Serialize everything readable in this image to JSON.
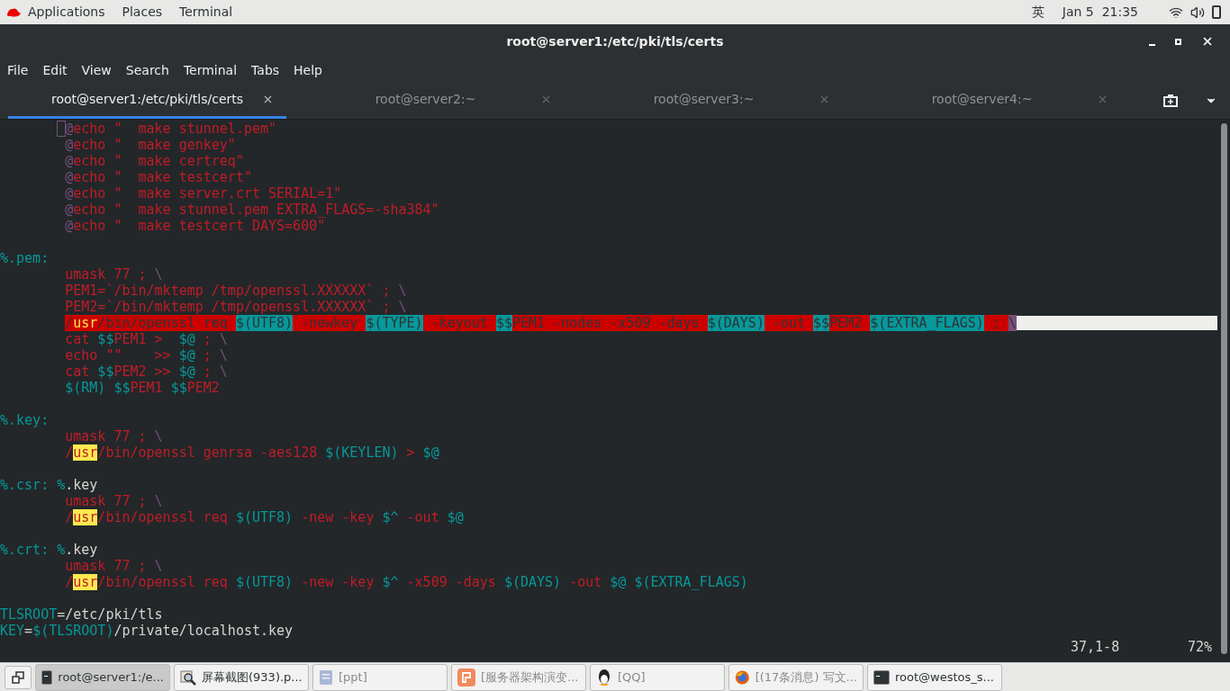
{
  "top_bar": {
    "menus": [
      "Applications",
      "Places",
      "Terminal"
    ],
    "input_method": "英",
    "clock": "Jan 5  21:35"
  },
  "window": {
    "title": "root@server1:/etc/pki/tls/certs"
  },
  "menu_bar": [
    "File",
    "Edit",
    "View",
    "Search",
    "Terminal",
    "Tabs",
    "Help"
  ],
  "tabs": [
    {
      "label": "root@server1:/etc/pki/tls/certs",
      "selected": true
    },
    {
      "label": "root@server2:~",
      "selected": false
    },
    {
      "label": "root@server3:~",
      "selected": false
    },
    {
      "label": "root@server4:~",
      "selected": false
    }
  ],
  "editor": {
    "lines": [
      {
        "indented": true,
        "cursor": true,
        "segments": [
          {
            "kind": "purple",
            "text": "@"
          },
          {
            "kind": "red",
            "text": "echo \"  make stunnel.pem\""
          }
        ]
      },
      {
        "indented": true,
        "segments": [
          {
            "kind": "purple",
            "text": "@"
          },
          {
            "kind": "red",
            "text": "echo \"  make genkey\""
          }
        ]
      },
      {
        "indented": true,
        "segments": [
          {
            "kind": "purple",
            "text": "@"
          },
          {
            "kind": "red",
            "text": "echo \"  make certreq\""
          }
        ]
      },
      {
        "indented": true,
        "segments": [
          {
            "kind": "purple",
            "text": "@"
          },
          {
            "kind": "red",
            "text": "echo \"  make testcert\""
          }
        ]
      },
      {
        "indented": true,
        "segments": [
          {
            "kind": "purple",
            "text": "@"
          },
          {
            "kind": "red",
            "text": "echo \"  make server.crt SERIAL=1\""
          }
        ]
      },
      {
        "indented": true,
        "segments": [
          {
            "kind": "purple",
            "text": "@"
          },
          {
            "kind": "red",
            "text": "echo \"  make stunnel.pem EXTRA_FLAGS=-sha384\""
          }
        ]
      },
      {
        "indented": true,
        "segments": [
          {
            "kind": "purple",
            "text": "@"
          },
          {
            "kind": "red",
            "text": "echo \"  make testcert DAYS=600\""
          }
        ]
      },
      {
        "kind": "blank"
      },
      {
        "segments": [
          {
            "kind": "cyan",
            "text": "%.pem:"
          }
        ]
      },
      {
        "indented": true,
        "segments": [
          {
            "kind": "red",
            "text": "umask 77 ; "
          },
          {
            "kind": "purple",
            "text": "\\"
          }
        ]
      },
      {
        "indented": true,
        "segments": [
          {
            "kind": "red",
            "text": "PEM1=`/bin/mktemp /tmp/openssl.XXXXXX` ; "
          },
          {
            "kind": "purple",
            "text": "\\"
          }
        ]
      },
      {
        "indented": true,
        "segments": [
          {
            "kind": "red",
            "text": "PEM2=`/bin/mktemp /tmp/openssl.XXXXXX` ; "
          },
          {
            "kind": "purple",
            "text": "\\"
          }
        ]
      },
      {
        "indented": true,
        "trailing_whitespace": true,
        "segments": [
          {
            "kind": "err",
            "text": "/"
          },
          {
            "kind": "errmatch",
            "text": "usr"
          },
          {
            "kind": "err",
            "text": "/bin/openssl req "
          },
          {
            "kind": "errvar",
            "text": "$(UTF8)"
          },
          {
            "kind": "err",
            "text": " -newkey "
          },
          {
            "kind": "errvar",
            "text": "$(TYPE)"
          },
          {
            "kind": "err",
            "text": " -keyout "
          },
          {
            "kind": "errvar",
            "text": "$$"
          },
          {
            "kind": "err",
            "text": "PEM1 -nodes -x509 -days "
          },
          {
            "kind": "errvar",
            "text": "$(DAYS)"
          },
          {
            "kind": "err",
            "text": " -out "
          },
          {
            "kind": "errvar",
            "text": "$$"
          },
          {
            "kind": "err",
            "text": "PEM2 "
          },
          {
            "kind": "errvar",
            "text": "$(EXTRA_FLAGS)"
          },
          {
            "kind": "err",
            "text": " ; "
          },
          {
            "kind": "errend",
            "text": "\\"
          }
        ]
      },
      {
        "indented": true,
        "segments": [
          {
            "kind": "red",
            "text": "cat "
          },
          {
            "kind": "cyan",
            "text": "$$"
          },
          {
            "kind": "red",
            "text": "PEM1 >  "
          },
          {
            "kind": "cyan",
            "text": "$@"
          },
          {
            "kind": "red",
            "text": " ; "
          },
          {
            "kind": "purple",
            "text": "\\"
          }
        ]
      },
      {
        "indented": true,
        "segments": [
          {
            "kind": "red",
            "text": "echo \"\"    >> "
          },
          {
            "kind": "cyan",
            "text": "$@"
          },
          {
            "kind": "red",
            "text": " ; "
          },
          {
            "kind": "purple",
            "text": "\\"
          }
        ]
      },
      {
        "indented": true,
        "segments": [
          {
            "kind": "red",
            "text": "cat "
          },
          {
            "kind": "cyan",
            "text": "$$"
          },
          {
            "kind": "red",
            "text": "PEM2 >> "
          },
          {
            "kind": "cyan",
            "text": "$@"
          },
          {
            "kind": "red",
            "text": " ; "
          },
          {
            "kind": "purple",
            "text": "\\"
          }
        ]
      },
      {
        "indented": true,
        "segments": [
          {
            "kind": "cyan",
            "text": "$(RM) $$"
          },
          {
            "kind": "red",
            "text": "PEM1 "
          },
          {
            "kind": "cyan",
            "text": "$$"
          },
          {
            "kind": "red",
            "text": "PEM2"
          }
        ]
      },
      {
        "kind": "blank"
      },
      {
        "segments": [
          {
            "kind": "cyan",
            "text": "%.key:"
          }
        ]
      },
      {
        "indented": true,
        "segments": [
          {
            "kind": "red",
            "text": "umask 77 ; "
          },
          {
            "kind": "purple",
            "text": "\\"
          }
        ]
      },
      {
        "indented": true,
        "segments": [
          {
            "kind": "red",
            "text": "/"
          },
          {
            "kind": "match",
            "text": "usr"
          },
          {
            "kind": "red",
            "text": "/bin/openssl genrsa -aes128 "
          },
          {
            "kind": "cyan",
            "text": "$(KEYLEN)"
          },
          {
            "kind": "red",
            "text": " > "
          },
          {
            "kind": "cyan",
            "text": "$@"
          }
        ]
      },
      {
        "kind": "blank"
      },
      {
        "segments": [
          {
            "kind": "cyan",
            "text": "%.csr: %"
          },
          {
            "kind": "white",
            "text": ".key"
          }
        ]
      },
      {
        "indented": true,
        "segments": [
          {
            "kind": "red",
            "text": "umask 77 ; "
          },
          {
            "kind": "purple",
            "text": "\\"
          }
        ]
      },
      {
        "indented": true,
        "segments": [
          {
            "kind": "red",
            "text": "/"
          },
          {
            "kind": "match",
            "text": "usr"
          },
          {
            "kind": "red",
            "text": "/bin/openssl req "
          },
          {
            "kind": "cyan",
            "text": "$(UTF8)"
          },
          {
            "kind": "red",
            "text": " -new -key "
          },
          {
            "kind": "cyan",
            "text": "$^"
          },
          {
            "kind": "red",
            "text": " -out "
          },
          {
            "kind": "cyan",
            "text": "$@"
          }
        ]
      },
      {
        "kind": "blank"
      },
      {
        "segments": [
          {
            "kind": "cyan",
            "text": "%.crt: %"
          },
          {
            "kind": "white",
            "text": ".key"
          }
        ]
      },
      {
        "indented": true,
        "segments": [
          {
            "kind": "red",
            "text": "umask 77 ; "
          },
          {
            "kind": "purple",
            "text": "\\"
          }
        ]
      },
      {
        "indented": true,
        "segments": [
          {
            "kind": "red",
            "text": "/"
          },
          {
            "kind": "match",
            "text": "usr"
          },
          {
            "kind": "red",
            "text": "/bin/openssl req "
          },
          {
            "kind": "cyan",
            "text": "$(UTF8)"
          },
          {
            "kind": "red",
            "text": " -new -key "
          },
          {
            "kind": "cyan",
            "text": "$^"
          },
          {
            "kind": "red",
            "text": " -x509 -days "
          },
          {
            "kind": "cyan",
            "text": "$(DAYS)"
          },
          {
            "kind": "red",
            "text": " -out "
          },
          {
            "kind": "cyan",
            "text": "$@ $(EXTRA_FLAGS)"
          }
        ]
      },
      {
        "kind": "blank"
      },
      {
        "segments": [
          {
            "kind": "cyan",
            "text": "TLSROOT"
          },
          {
            "kind": "white",
            "text": "=/etc/pki/tls"
          }
        ]
      },
      {
        "segments": [
          {
            "kind": "cyan",
            "text": "KEY"
          },
          {
            "kind": "white",
            "text": "="
          },
          {
            "kind": "cyan",
            "text": "$(TLSROOT)"
          },
          {
            "kind": "white",
            "text": "/private/localhost.key"
          }
        ]
      }
    ],
    "ruler": {
      "position": "37,1-8",
      "percent": "72%"
    }
  },
  "taskbar": {
    "items": [
      {
        "kind": "terminal",
        "label": "root@server1:/e...",
        "selected": true,
        "minimized": false
      },
      {
        "kind": "image",
        "label": "屏幕截图(933).p...",
        "selected": false,
        "minimized": false
      },
      {
        "kind": "document",
        "label": "[ppt]",
        "selected": false,
        "minimized": true
      },
      {
        "kind": "slides",
        "label": "[服务器架构演变...",
        "selected": false,
        "minimized": true
      },
      {
        "kind": "penguin",
        "label": "[QQ]",
        "selected": false,
        "minimized": true
      },
      {
        "kind": "browser",
        "label": "[(17条消息) 写文...",
        "selected": false,
        "minimized": true
      },
      {
        "kind": "terminal",
        "label": "root@westos_s...",
        "selected": false,
        "minimized": false
      }
    ]
  }
}
